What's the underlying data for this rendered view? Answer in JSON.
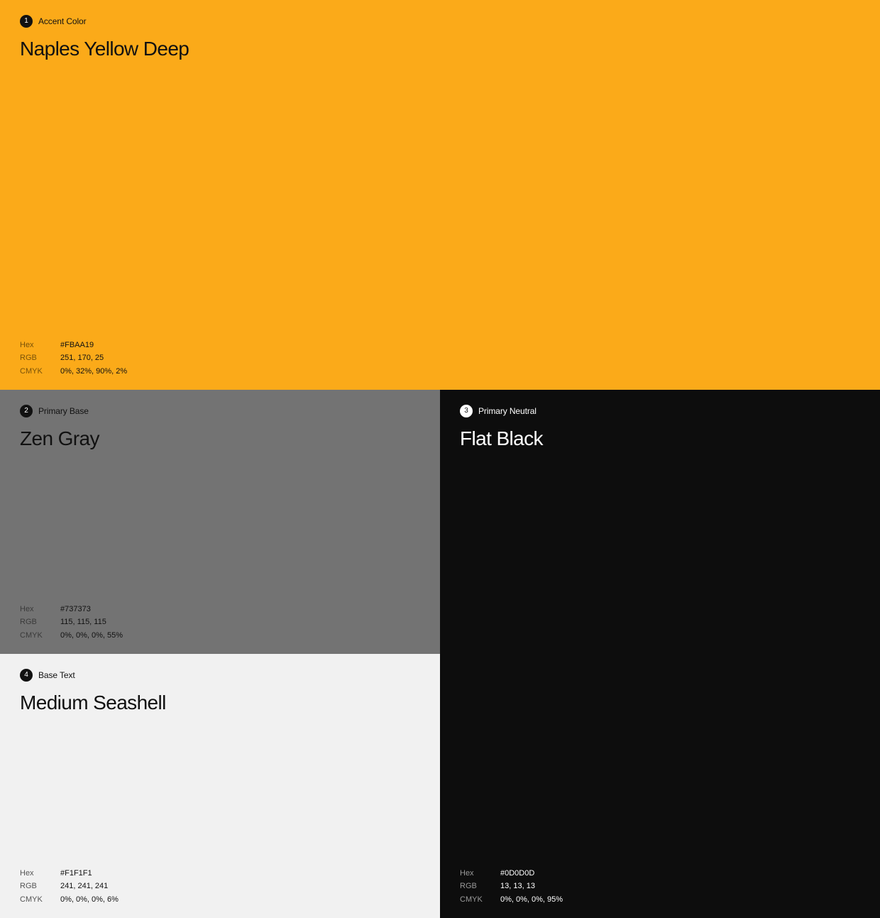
{
  "swatches": [
    {
      "number": "1",
      "role": "Accent Color",
      "name": "Naples Yellow Deep",
      "color": "#FBAA19",
      "hex_label": "Hex",
      "hex": "#FBAA19",
      "rgb_label": "RGB",
      "rgb": "251, 170, 25",
      "cmyk_label": "CMYK",
      "cmyk": "0%, 32%, 90%, 2%"
    },
    {
      "number": "2",
      "role": "Primary Base",
      "name": "Zen Gray",
      "color": "#737373",
      "hex_label": "Hex",
      "hex": "#737373",
      "rgb_label": "RGB",
      "rgb": "115, 115, 115",
      "cmyk_label": "CMYK",
      "cmyk": "0%, 0%, 0%, 55%"
    },
    {
      "number": "3",
      "role": "Primary Neutral",
      "name": "Flat Black",
      "color": "#0D0D0D",
      "hex_label": "Hex",
      "hex": "#0D0D0D",
      "rgb_label": "RGB",
      "rgb": "13, 13, 13",
      "cmyk_label": "CMYK",
      "cmyk": "0%, 0%, 0%, 95%"
    },
    {
      "number": "4",
      "role": "Base Text",
      "name": "Medium Seashell",
      "color": "#F1F1F1",
      "hex_label": "Hex",
      "hex": "#F1F1F1",
      "rgb_label": "RGB",
      "rgb": "241, 241, 241",
      "cmyk_label": "CMYK",
      "cmyk": "0%, 0%, 0%, 6%"
    }
  ]
}
